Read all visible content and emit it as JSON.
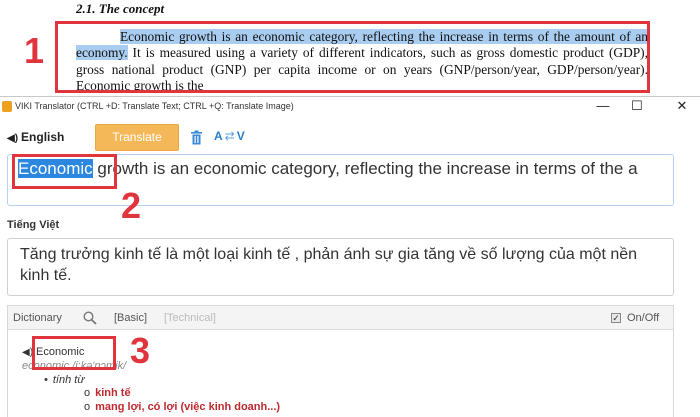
{
  "document": {
    "heading": "2.1. The concept",
    "highlighted_text": "Economic growth is an economic category, reflecting the increase in terms of the amount of an economy.",
    "continuation_text": "It is measured using a variety of different indicators, such as gross domestic product (GDP), gross national product (GNP) per capita income or on years (GNP/person/year, GDP/person/year). Economic growth is the"
  },
  "annotations": {
    "marker_1": "1",
    "marker_2": "2",
    "marker_3": "3",
    "color": "#e0353d"
  },
  "window": {
    "title": "VIKI Translator (CTRL +D: Translate Text; CTRL +Q: Translate Image)",
    "minimize_glyph": "—",
    "maximize_glyph": "☐",
    "close_glyph": "✕"
  },
  "toolbar": {
    "source_language": "English",
    "translate_label": "Translate",
    "swap_from": "A",
    "swap_to": "V",
    "accent_color": "#f5b859"
  },
  "source": {
    "selected_word": "Economic",
    "rest_text": " growth is an economic category, reflecting the increase in terms of the a"
  },
  "target": {
    "language_label": "Tiếng Việt",
    "text": "Tăng trưởng kinh tế là một loại kinh tế , phản ánh sự gia tăng về số lượng của một nền kinh tế."
  },
  "dictionary": {
    "title": "Dictionary",
    "tab_basic": "[Basic]",
    "tab_technical": "[Technical]",
    "toggle_label": "On/Off",
    "toggle_checked": true,
    "word": "Economic",
    "phonetic": "economic /i:kə'nɔmik/",
    "part_of_speech": "tính từ",
    "definitions": [
      "kinh tế",
      "mang lợi, có lợi (việc kinh doanh...)"
    ]
  }
}
